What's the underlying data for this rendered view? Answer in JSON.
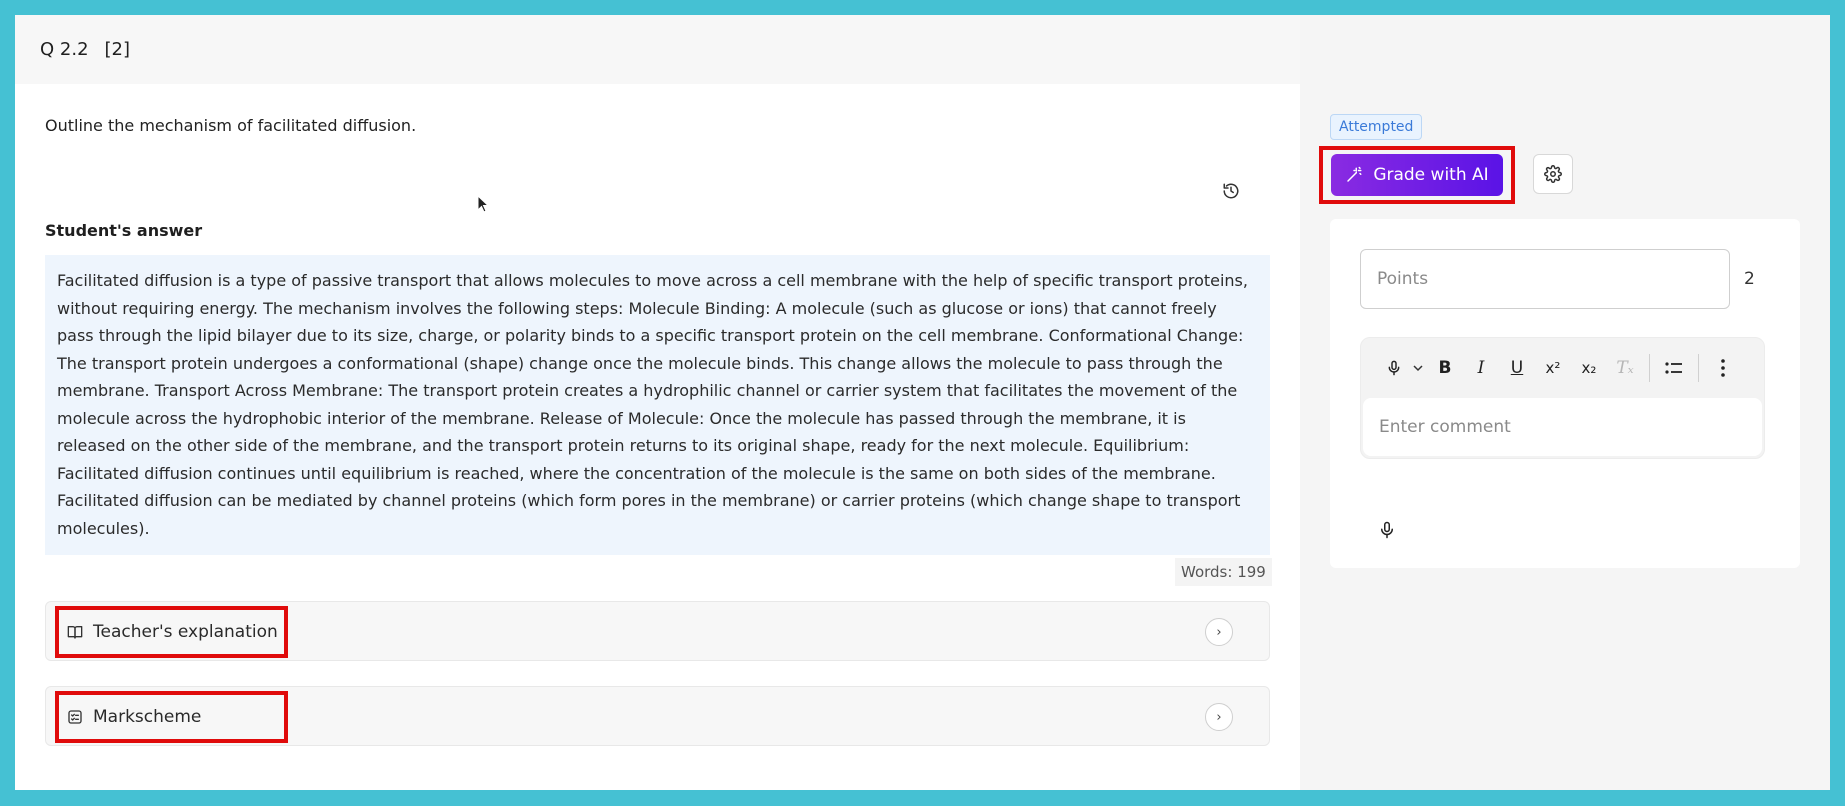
{
  "header": {
    "question_number": "Q 2.2",
    "marks": "[2]"
  },
  "question": {
    "text": "Outline the mechanism of facilitated diffusion."
  },
  "answer": {
    "heading": "Student's answer",
    "text": "Facilitated diffusion is a type of passive transport that allows molecules to move across a cell membrane with the help of specific transport proteins, without requiring energy. The mechanism involves the following steps: Molecule Binding: A molecule (such as glucose or ions) that cannot freely pass through the lipid bilayer due to its size, charge, or polarity binds to a specific transport protein on the cell membrane. Conformational Change: The transport protein undergoes a conformational (shape) change once the molecule binds. This change allows the molecule to pass through the membrane. Transport Across Membrane: The transport protein creates a hydrophilic channel or carrier system that facilitates the movement of the molecule across the hydrophobic interior of the membrane. Release of Molecule: Once the molecule has passed through the membrane, it is released on the other side of the membrane, and the transport protein returns to its original shape, ready for the next molecule. Equilibrium: Facilitated diffusion continues until equilibrium is reached, where the concentration of the molecule is the same on both sides of the membrane. Facilitated diffusion can be mediated by channel proteins (which form pores in the membrane) or carrier proteins (which change shape to transport molecules).",
    "word_count": "Words: 199"
  },
  "accordions": [
    {
      "label": "Teacher's explanation",
      "icon": "open-book-icon"
    },
    {
      "label": "Markscheme",
      "icon": "checklist-icon"
    }
  ],
  "grading": {
    "status_badge": "Attempted",
    "grade_button_label": "Grade with AI",
    "points_placeholder": "Points",
    "points_max": "2",
    "comment_placeholder": "Enter comment"
  },
  "toolbar": {
    "bold": "B",
    "italic": "I",
    "underline": "U",
    "superscript": "x²",
    "subscript": "x₂",
    "clear_format": "Tₓ"
  },
  "colors": {
    "background": "#45c1d3",
    "highlight_outline": "#e00b0b",
    "grade_button": "#7a22e4",
    "answer_bg": "#eef5fd",
    "badge_text": "#3a7ad8"
  }
}
